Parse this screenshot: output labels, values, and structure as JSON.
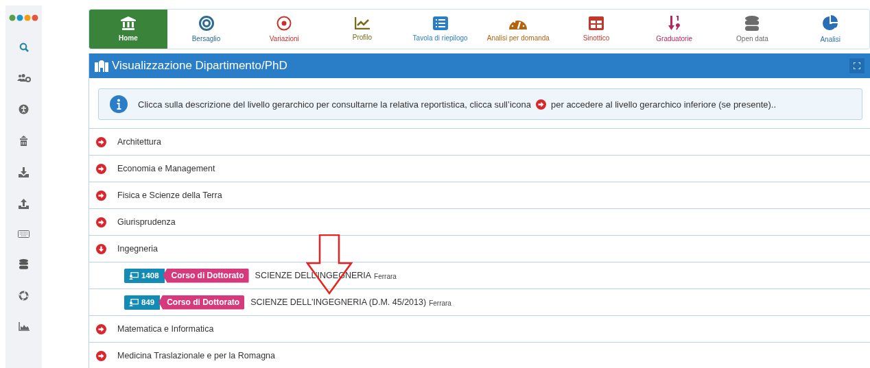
{
  "sidebar": {
    "items": [
      {
        "kind": "search"
      },
      {
        "kind": "users-gear"
      },
      {
        "kind": "accessibility"
      },
      {
        "kind": "building"
      },
      {
        "kind": "download"
      },
      {
        "kind": "upload"
      },
      {
        "kind": "keyboard"
      },
      {
        "kind": "database"
      },
      {
        "kind": "lifebuoy"
      },
      {
        "kind": "area-chart"
      }
    ]
  },
  "nav": [
    {
      "label": "Home",
      "kind": "home",
      "color": "#3a833a",
      "selected": true
    },
    {
      "label": "Bersaglio",
      "kind": "target",
      "color": "#2b6b94",
      "selected": false
    },
    {
      "label": "Variazioni",
      "kind": "dot-circle",
      "color": "#c9302c",
      "selected": false
    },
    {
      "label": "Profilo",
      "kind": "line-chart",
      "color": "#7a6a1a",
      "selected": false
    },
    {
      "label": "Tavola di riepilogo",
      "kind": "list",
      "color": "#2a7ec8",
      "selected": false
    },
    {
      "label": "Analisi per domanda",
      "kind": "gauge",
      "color": "#b5620c",
      "selected": false
    },
    {
      "label": "Sinottico",
      "kind": "table",
      "color": "#c0392b",
      "selected": false
    },
    {
      "label": "Graduatorie",
      "kind": "sort",
      "color": "#b5285f",
      "selected": false
    },
    {
      "label": "Open data",
      "kind": "database",
      "color": "#6b6b6b",
      "selected": false
    },
    {
      "label": "Analisi",
      "kind": "pie",
      "color": "#2a6fb5",
      "selected": false
    }
  ],
  "panel": {
    "title": "Visualizzazione Dipartimento/PhD",
    "info": {
      "before": "Clicca sulla descrizione del livello gerarchico per consultarne la relativa reportistica, clicca sull’icona",
      "after": "per accedere al livello gerarchico inferiore (se presente).."
    },
    "departments": [
      {
        "name": "Architettura",
        "expanded": false
      },
      {
        "name": "Economia e Management",
        "expanded": false
      },
      {
        "name": "Fisica e Scienze della Terra",
        "expanded": false
      },
      {
        "name": "Giurisprudenza",
        "expanded": false
      },
      {
        "name": "Ingegneria",
        "expanded": true,
        "children": [
          {
            "count": "1408",
            "type": "Corso di Dottorato",
            "name": "SCIENZE DELL’INGEGNERIA",
            "city": "Ferrara"
          },
          {
            "count": "849",
            "type": "Corso di Dottorato",
            "name": "SCIENZE DELL'INGEGNERIA (D.M. 45/2013)",
            "city": "Ferrara"
          }
        ]
      },
      {
        "name": "Matematica e Informatica",
        "expanded": false
      },
      {
        "name": "Medicina Traslazionale e per la Romagna",
        "expanded": false
      }
    ]
  }
}
